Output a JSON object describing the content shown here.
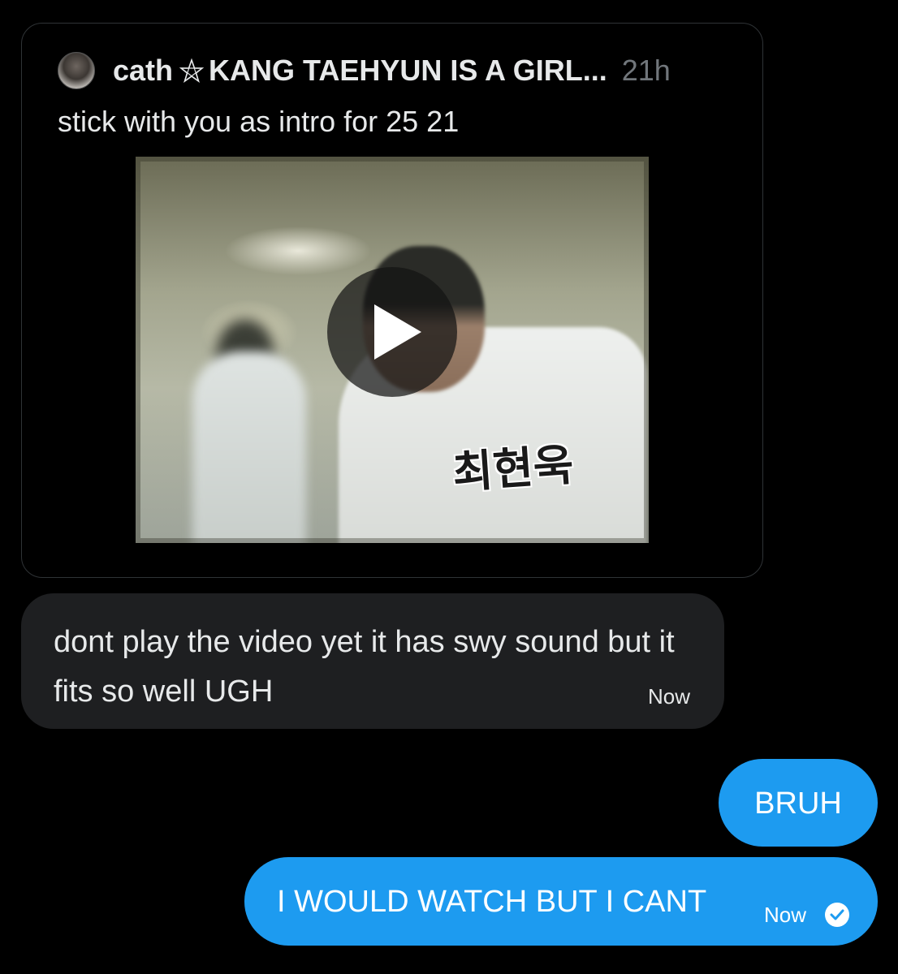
{
  "quoted_post": {
    "author_name": "cath",
    "author_badge_icon": "pentagram-icon",
    "display_name": "KANG TAEHYUN IS A GIRL...",
    "time": "21h",
    "text": "stick with you as intro for 25 21",
    "video": {
      "caption": "최현욱",
      "play_icon": "play-icon"
    }
  },
  "messages": [
    {
      "direction": "received",
      "text": "dont play the video yet it has swy sound but it fits so well UGH",
      "time": "Now"
    },
    {
      "direction": "sent",
      "text": "BRUH"
    },
    {
      "direction": "sent",
      "text": "I WOULD WATCH BUT I CANT",
      "time": "Now",
      "status_icon": "read-check-icon"
    }
  ],
  "colors": {
    "background": "#000000",
    "received_bubble": "#1e1f21",
    "sent_bubble": "#1d9bf0",
    "secondary_text": "#71767b"
  }
}
